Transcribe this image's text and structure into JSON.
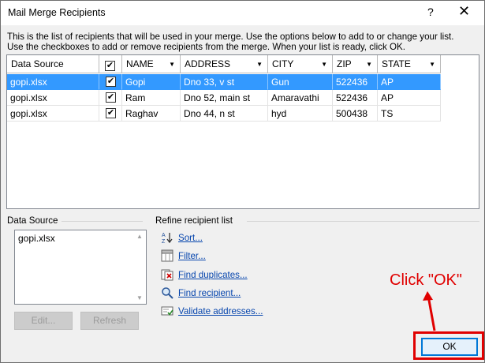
{
  "window": {
    "title": "Mail Merge Recipients",
    "help_glyph": "?",
    "close_glyph": "✕"
  },
  "description": {
    "line1": "This is the list of recipients that will be used in your merge.  Use the options below to add to or change your list.",
    "line2": "Use the checkboxes to add or remove recipients from the merge.  When your list is ready, click OK."
  },
  "grid": {
    "columns": [
      "Data Source",
      "",
      "NAME",
      "ADDRESS",
      "CITY",
      "ZIP",
      "STATE"
    ],
    "rows": [
      {
        "source": "gopi.xlsx",
        "checked": true,
        "name": "Gopi",
        "address": "Dno 33, v st",
        "city": "Gun",
        "zip": "522436",
        "state": "AP",
        "selected": true
      },
      {
        "source": "gopi.xlsx",
        "checked": true,
        "name": "Ram",
        "address": "Dno 52, main st",
        "city": "Amaravathi",
        "zip": "522436",
        "state": "AP",
        "selected": false
      },
      {
        "source": "gopi.xlsx",
        "checked": true,
        "name": "Raghav",
        "address": "Dno 44, n st",
        "city": "hyd",
        "zip": "500438",
        "state": "TS",
        "selected": false
      }
    ],
    "check_glyph": "✔",
    "sort_glyph": "▼"
  },
  "data_source": {
    "label": "Data Source",
    "items": [
      "gopi.xlsx"
    ],
    "edit_label": "Edit...",
    "refresh_label": "Refresh"
  },
  "refine": {
    "label": "Refine recipient list",
    "links": [
      {
        "label": "Sort...",
        "icon": "sort-az-icon"
      },
      {
        "label": "Filter...",
        "icon": "filter-icon"
      },
      {
        "label": "Find duplicates...",
        "icon": "find-duplicates-icon"
      },
      {
        "label": "Find recipient...",
        "icon": "find-recipient-icon"
      },
      {
        "label": "Validate addresses...",
        "icon": "validate-addresses-icon"
      }
    ]
  },
  "ok_label": "OK",
  "annotation": {
    "text": "Click \"OK\"",
    "color": "#e00000"
  },
  "colors": {
    "selection": "#3399ff",
    "link": "#0645ad",
    "dialog_bg": "#f0f0f0"
  }
}
